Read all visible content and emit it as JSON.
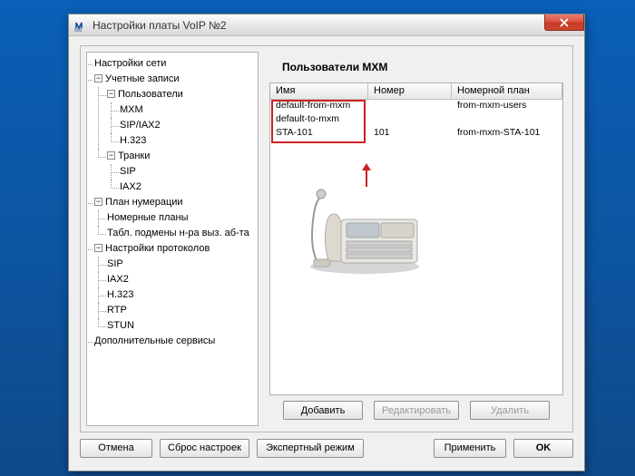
{
  "window": {
    "title": "Настройки платы VoIP №2"
  },
  "tree": {
    "n_network": "Настройки сети",
    "n_accounts": "Учетные записи",
    "n_users": "Пользователи",
    "n_mxm": "MXM",
    "n_sipiax2": "SIP/IAX2",
    "n_h323": "H.323",
    "n_trunks": "Транки",
    "n_sip": "SIP",
    "n_iax2": "IAX2",
    "n_dialplan": "План нумерации",
    "n_numplans": "Номерные планы",
    "n_subst": "Табл. подмены н-ра выз. аб-та",
    "n_protocols": "Настройки протоколов",
    "n_p_sip": "SIP",
    "n_p_iax2": "IAX2",
    "n_p_h323": "H.323",
    "n_p_rtp": "RTP",
    "n_p_stun": "STUN",
    "n_extra": "Дополнительные сервисы",
    "exp_minus": "−",
    "exp_plus": "+"
  },
  "panel": {
    "title": "Пользователи MXM",
    "columns": {
      "name": "Имя",
      "number": "Номер",
      "plan": "Номерной план"
    },
    "rows": [
      {
        "name": "default-from-mxm",
        "number": "",
        "plan": "from-mxm-users"
      },
      {
        "name": "default-to-mxm",
        "number": "",
        "plan": ""
      },
      {
        "name": "STA-101",
        "number": "101",
        "plan": "from-mxm-STA-101"
      }
    ],
    "buttons": {
      "add": "Добавить",
      "edit": "Редактировать",
      "delete": "Удалить"
    }
  },
  "footer": {
    "cancel": "Отмена",
    "reset": "Сброс настроек",
    "expert": "Экспертный режим",
    "apply": "Применить",
    "ok": "OK"
  }
}
